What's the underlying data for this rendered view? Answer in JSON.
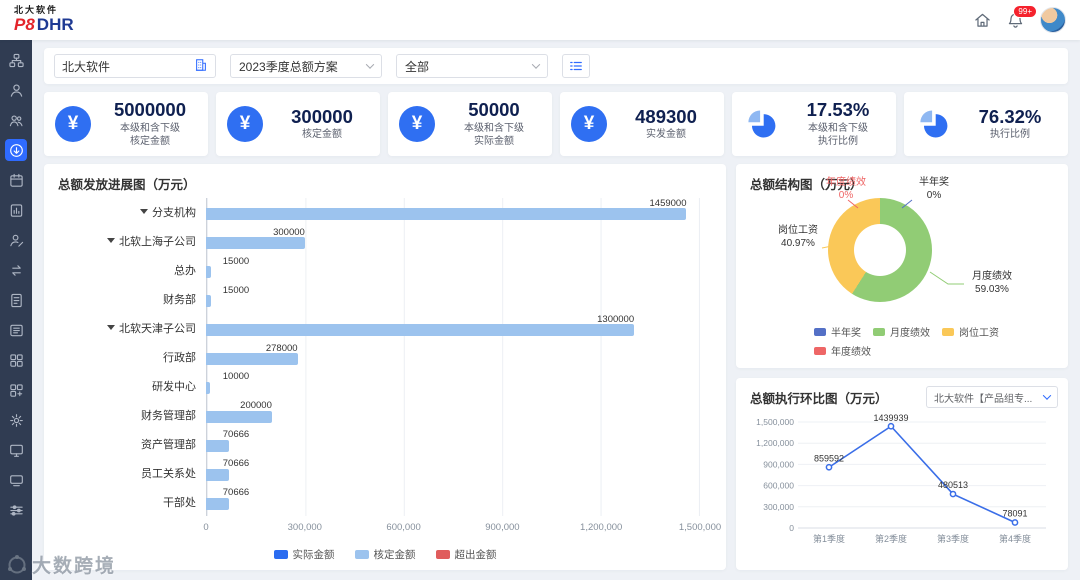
{
  "header": {
    "brand_top": "北大软件",
    "brand_p8": "P8",
    "brand_dhr": "DHR",
    "notification_badge": "99+"
  },
  "sidebar": {
    "items": [
      {
        "name": "org-structure-icon",
        "icon": "org",
        "active": false
      },
      {
        "name": "user-icon",
        "icon": "user",
        "active": false
      },
      {
        "name": "team-icon",
        "icon": "users",
        "active": false
      },
      {
        "name": "total-budget-icon",
        "icon": "circleArrow",
        "active": true
      },
      {
        "name": "calendar-icon",
        "icon": "calendar",
        "active": false
      },
      {
        "name": "report-chart-icon",
        "icon": "chart",
        "active": false
      },
      {
        "name": "user-edit-icon",
        "icon": "userEdit",
        "active": false
      },
      {
        "name": "transfer-icon",
        "icon": "exchange",
        "active": false
      },
      {
        "name": "document-icon",
        "icon": "doc",
        "active": false
      },
      {
        "name": "document-list-icon",
        "icon": "docs",
        "active": false
      },
      {
        "name": "apps-grid-icon",
        "icon": "grid",
        "active": false
      },
      {
        "name": "apps-add-icon",
        "icon": "gridPlus",
        "active": false
      },
      {
        "name": "settings-gear-icon",
        "icon": "gear",
        "active": false
      },
      {
        "name": "monitor-icon",
        "icon": "monitor",
        "active": false
      },
      {
        "name": "screen-icon",
        "icon": "screen",
        "active": false
      },
      {
        "name": "preferences-icon",
        "icon": "sliders",
        "active": false
      }
    ]
  },
  "filters": {
    "org_value": "北大软件",
    "plan_value": "2023季度总额方案",
    "scope_value": "全部"
  },
  "stat_cards": [
    {
      "icon": "yen",
      "value": "5000000",
      "label": "本级和含下级\n核定金额"
    },
    {
      "icon": "yen",
      "value": "300000",
      "label": "核定金额"
    },
    {
      "icon": "yen",
      "value": "50000",
      "label": "本级和含下级\n实际金额"
    },
    {
      "icon": "yen",
      "value": "489300",
      "label": "实发金额"
    },
    {
      "icon": "pie",
      "value": "17.53%",
      "label": "本级和含下级\n执行比例"
    },
    {
      "icon": "pie",
      "value": "76.32%",
      "label": "执行比例"
    }
  ],
  "chart_data": [
    {
      "type": "bar",
      "title": "总额发放进展图（万元）",
      "orientation": "horizontal",
      "categories": [
        "分支机构",
        "北软上海子公司",
        "总办",
        "财务部",
        "北软天津子公司",
        "行政部",
        "研发中心",
        "财务管理部",
        "资产管理部",
        "员工关系处",
        "干部处"
      ],
      "expandable": [
        true,
        true,
        false,
        false,
        true,
        false,
        false,
        false,
        false,
        false,
        false
      ],
      "values": [
        1459000,
        300000,
        15000,
        15000,
        1300000,
        278000,
        10000,
        200000,
        70666,
        70666,
        70666
      ],
      "xlim": [
        0,
        1500000
      ],
      "x_ticks": [
        "0",
        "300,000",
        "600,000",
        "900,000",
        "1,200,000",
        "1,500,000"
      ],
      "bar_color": "#9cc3ee",
      "legend": [
        {
          "label": "实际金额",
          "color": "#2b6cf0"
        },
        {
          "label": "核定金额",
          "color": "#9cc3ee"
        },
        {
          "label": "超出金额",
          "color": "#e05c5c"
        }
      ]
    },
    {
      "type": "pie",
      "title": "总额结构图（万元）",
      "segments": [
        {
          "label": "月度绩效",
          "pct": 59.03,
          "display": "59.03%",
          "color": "#91cc75"
        },
        {
          "label": "岗位工资",
          "pct": 40.97,
          "display": "40.97%",
          "color": "#fac858"
        },
        {
          "label": "年度绩效",
          "pct": 0,
          "display": "0%",
          "color": "#ee6666"
        },
        {
          "label": "半年奖",
          "pct": 0,
          "display": "0%",
          "color": "#5470c6"
        }
      ],
      "legend_order": [
        "半年奖",
        "月度绩效",
        "岗位工资",
        "年度绩效"
      ]
    },
    {
      "type": "line",
      "title": "总额执行环比图（万元）",
      "filter_value": "北大软件【产品组专...",
      "categories": [
        "第1季度",
        "第2季度",
        "第3季度",
        "第4季度"
      ],
      "values": [
        859592,
        1439939,
        480513,
        78091
      ],
      "ylim": [
        0,
        1500000
      ],
      "y_ticks": [
        "1,500,000",
        "1,200,000",
        "900,000",
        "600,000",
        "300,000",
        "0"
      ],
      "line_color": "#3a6ee8"
    }
  ],
  "watermark": "大数跨境"
}
